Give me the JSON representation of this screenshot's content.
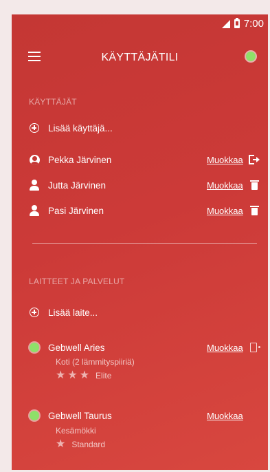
{
  "statusbar": {
    "time": "7:00"
  },
  "appbar": {
    "title": "KÄYTTÄJÄTILI"
  },
  "users": {
    "header": "KÄYTTÄJÄT",
    "add_label": "Lisää käyttäjä...",
    "items": [
      {
        "name": "Pekka Järvinen",
        "edit": "Muokkaa",
        "action": "logout-icon"
      },
      {
        "name": "Jutta Järvinen",
        "edit": "Muokkaa",
        "action": "trash-icon"
      },
      {
        "name": "Pasi Järvinen",
        "edit": "Muokkaa",
        "action": "trash-icon"
      }
    ]
  },
  "devices": {
    "header": "LAITTEET JA PALVELUT",
    "add_label": "Lisää laite...",
    "items": [
      {
        "name": "Gebwell Aries",
        "edit": "Muokkaa",
        "location": "Koti (2 lämmityspiiriä)",
        "stars": 3,
        "tier": "Elite",
        "status_color": "#8ee069"
      },
      {
        "name": "Gebwell Taurus",
        "edit": "Muokkaa",
        "location": "Kesämökki",
        "stars": 1,
        "tier": "Standard",
        "status_color": "#8ee069"
      }
    ]
  },
  "colors": {
    "background": "#c43734",
    "status_green": "#8ee069"
  }
}
